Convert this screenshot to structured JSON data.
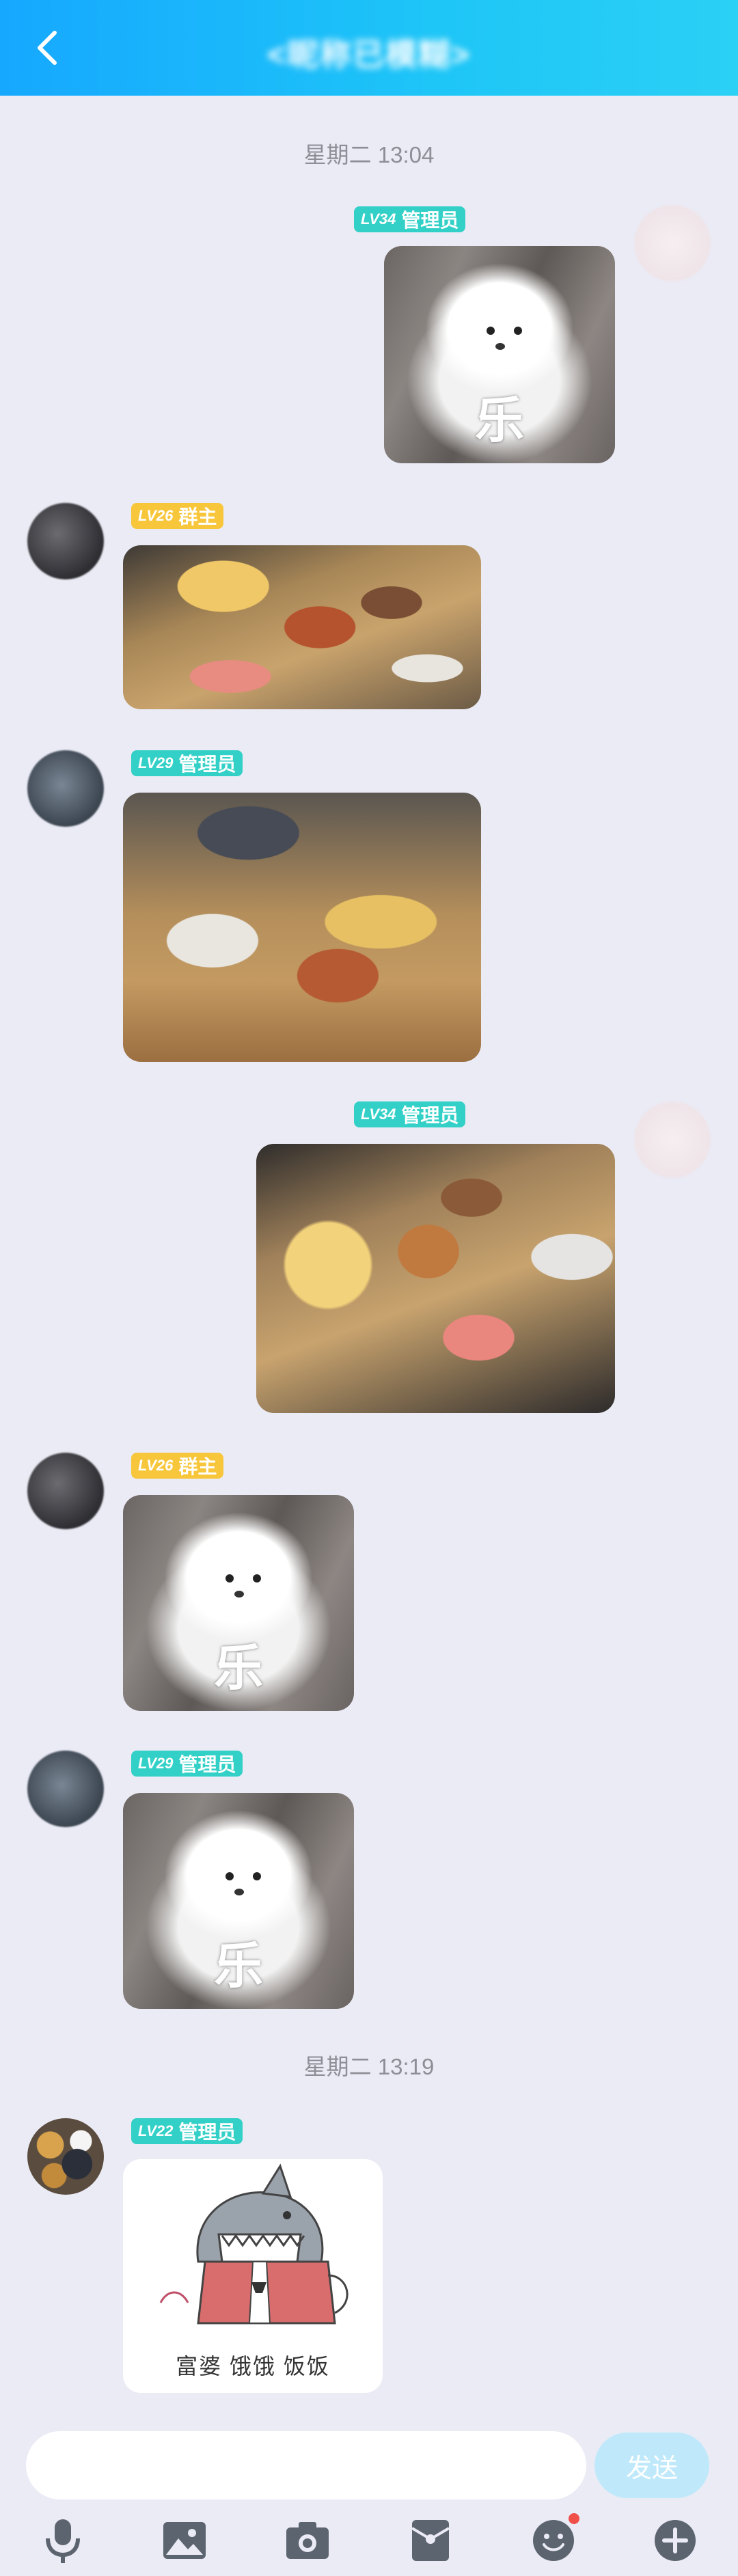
{
  "header": {
    "title": "<昵称已模糊>",
    "back_icon": "chevron-left-icon"
  },
  "timestamps": [
    "星期二 13:04",
    "星期二 13:19"
  ],
  "messages": [
    {
      "side": "right",
      "level": "LV34",
      "role": "管理员",
      "nickname": "",
      "content": "dog-sticker",
      "sticker_text": "乐"
    },
    {
      "side": "left",
      "level": "LV26",
      "role": "群主",
      "nickname": "",
      "content": "food-photo"
    },
    {
      "side": "left",
      "level": "LV29",
      "role": "管理员",
      "nickname": "",
      "content": "food-photo"
    },
    {
      "side": "right",
      "level": "LV34",
      "role": "管理员",
      "nickname": "",
      "content": "food-photo"
    },
    {
      "side": "left",
      "level": "LV26",
      "role": "群主",
      "nickname": "",
      "content": "dog-sticker",
      "sticker_text": "乐"
    },
    {
      "side": "left",
      "level": "LV29",
      "role": "管理员",
      "nickname": "",
      "content": "dog-sticker",
      "sticker_text": "乐"
    },
    {
      "side": "left",
      "level": "LV22",
      "role": "管理员",
      "nickname": "",
      "content": "shark-sticker",
      "sticker_text": "富婆 饿饿 饭饭"
    }
  ],
  "input": {
    "placeholder": "",
    "send_label": "发送"
  },
  "toolbar": [
    {
      "icon": "microphone-icon"
    },
    {
      "icon": "image-icon"
    },
    {
      "icon": "camera-icon"
    },
    {
      "icon": "red-packet-icon"
    },
    {
      "icon": "emoji-icon",
      "has_dot": true
    },
    {
      "icon": "plus-icon"
    }
  ],
  "colors": {
    "header_gradient_start": "#16a8ff",
    "header_gradient_end": "#2bd0f5",
    "background": "#ebebf5",
    "badge_teal": "#33d0c7",
    "badge_yellow": "#f7c63b",
    "send_button": "#bfe9fa",
    "notification_dot": "#f0504a"
  }
}
